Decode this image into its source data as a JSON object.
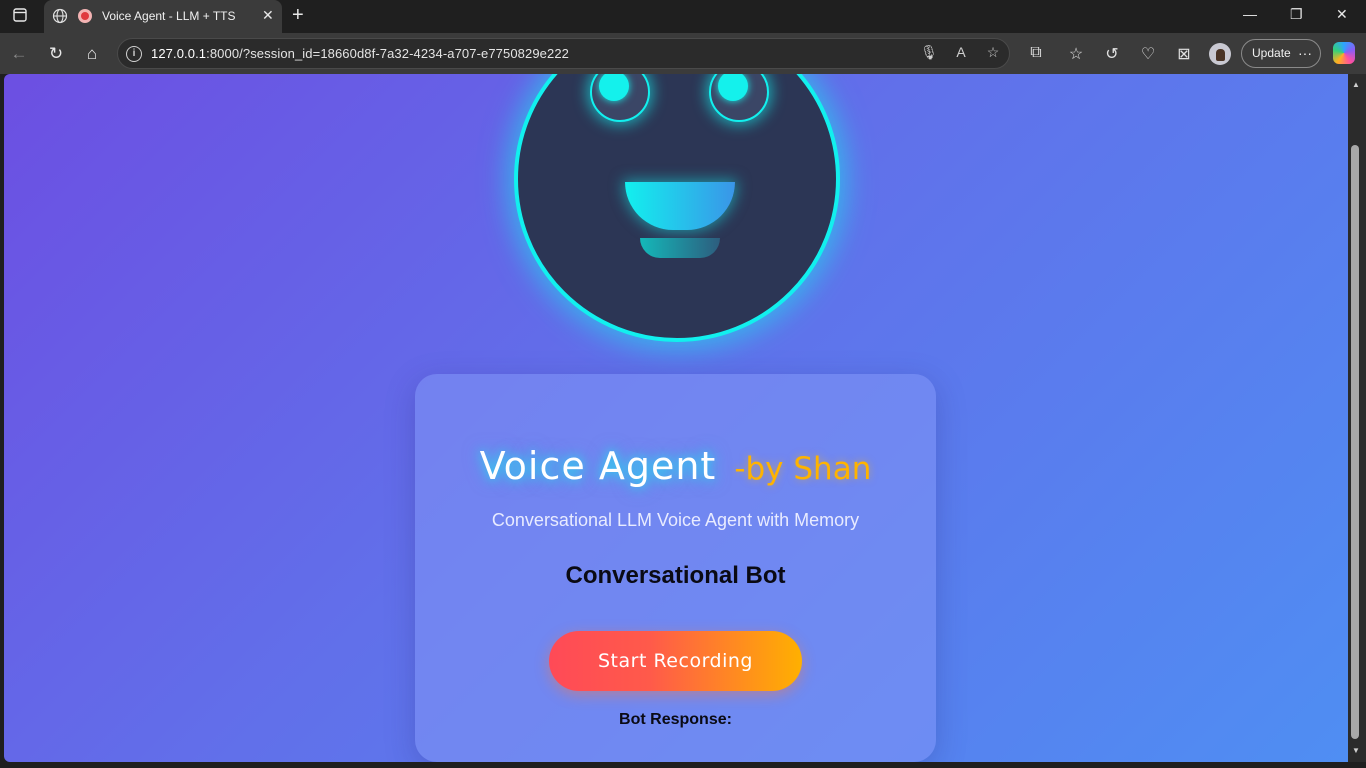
{
  "browser": {
    "tab_title": "Voice Agent - LLM + TTS",
    "url_host": "127.0.0.1",
    "url_rest": ":8000/?session_id=18660d8f-7a32-4234-a707-e7750829e222",
    "update_label": "Update",
    "update_dots": "···",
    "close_glyph": "✕",
    "newtab_glyph": "+",
    "minimize_glyph": "—",
    "restore_glyph": "❐",
    "winclose_glyph": "✕"
  },
  "page": {
    "title": "Voice Agent",
    "title_suffix": "-by Shan",
    "subtitle": "Conversational LLM Voice Agent with Memory",
    "heading": "Conversational Bot",
    "record_button": "Start Recording",
    "response_label": "Bot Response:"
  },
  "colors": {
    "accent_cyan": "#12f0ee",
    "accent_orange": "#ffb300",
    "button_start": "#ff4a57",
    "button_end": "#ffb000"
  },
  "icons": [
    "tab-actions-icon",
    "globe-icon",
    "recording-icon",
    "back-icon",
    "refresh-icon",
    "home-icon",
    "info-icon",
    "microphone-icon",
    "read-aloud-icon",
    "favorite-add-icon",
    "extensions-icon",
    "favorites-icon",
    "history-icon",
    "performance-icon",
    "screenshot-icon",
    "copilot-icon"
  ]
}
